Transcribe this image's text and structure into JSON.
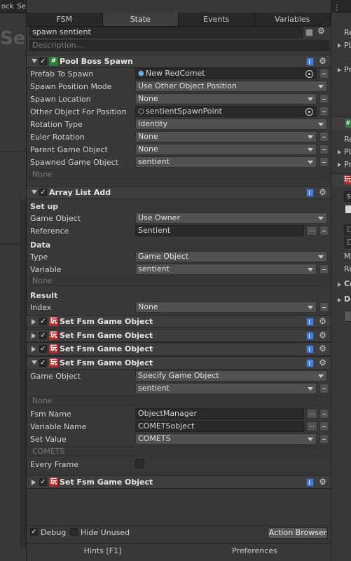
{
  "left_panel": {
    "tabs": [
      "ock",
      "Se"
    ],
    "big_text": "Se"
  },
  "tabs": [
    "FSM",
    "State",
    "Events",
    "Variables"
  ],
  "state": {
    "name": "spawn sentient",
    "description_placeholder": "Description..."
  },
  "actions": {
    "pool_boss_spawn": {
      "title": "Pool Boss Spawn",
      "rows": [
        {
          "label": "Prefab To Spawn",
          "value": "New RedComet"
        },
        {
          "label": "Spawn Position Mode",
          "value": "Use Other Object Position"
        },
        {
          "label": "Spawn Location",
          "value": "None"
        },
        {
          "label": "Other Object For Position",
          "value": "sentientSpawnPoint"
        },
        {
          "label": "Rotation Type",
          "value": "Identity"
        },
        {
          "label": "Euler Rotation",
          "value": "None"
        },
        {
          "label": "Parent Game Object",
          "value": "None"
        },
        {
          "label": "Spawned Game Object",
          "value": "sentient"
        }
      ],
      "none_row": "None"
    },
    "array_list_add": {
      "title": "Array List Add",
      "setup_label": "Set up",
      "game_object_label": "Game Object",
      "game_object_value": "Use Owner",
      "reference_label": "Reference",
      "reference_value": "Sentient",
      "data_label": "Data",
      "type_label": "Type",
      "type_value": "Game Object",
      "variable_label": "Variable",
      "variable_value": "sentient",
      "none_row": "None",
      "result_label": "Result",
      "index_label": "Index",
      "index_value": "None"
    },
    "collapsed": [
      "Set Fsm Game Object",
      "Set Fsm Game Object",
      "Set Fsm Game Object"
    ],
    "set_fsm_open": {
      "title": "Set Fsm Game Object",
      "game_object_label": "Game Object",
      "game_object_value": "Specify Game Object",
      "sub_value": "sentient",
      "none_row": "None",
      "fsm_name_label": "Fsm Name",
      "fsm_name_value": "ObjectManager",
      "variable_name_label": "Variable Name",
      "variable_name_value": "COMETSobject",
      "set_value_label": "Set Value",
      "set_value_value": "COMETS",
      "comets_row": "COMETS",
      "every_frame_label": "Every Frame"
    },
    "last": {
      "title": "Set Fsm Game Object"
    }
  },
  "bottom": {
    "debug": "Debug",
    "hide_unused": "Hide Unused",
    "action_browser": "Action Browser"
  },
  "hints": [
    "Hints [F1]",
    "Preferences"
  ],
  "right_panel": {
    "labels": [
      "Re",
      "PL",
      "Pr",
      "Re",
      "PL",
      "Pr",
      "s",
      "D",
      "D",
      "Ma",
      "Re",
      "Co",
      "De"
    ]
  },
  "colors": {
    "hash_icon": "#2c7b3a",
    "game_icon": "#b32a2a",
    "book_icon": "#4d7dd0"
  }
}
